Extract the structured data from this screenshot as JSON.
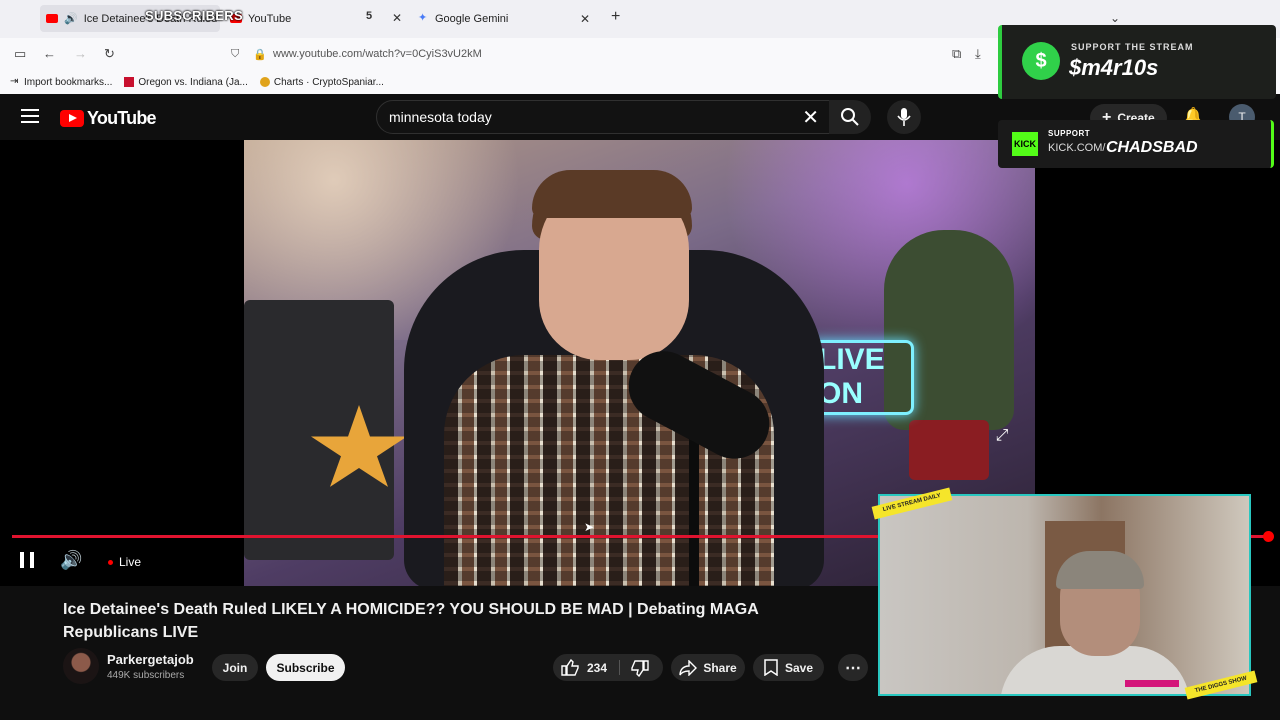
{
  "browser": {
    "tabs": [
      {
        "title": "Ice Detainee's Death Ruled"
      },
      {
        "title": "YouTube"
      },
      {
        "title": "Google Gemini"
      }
    ],
    "tab_overlay_text": "SUBSCRIBERS",
    "tab_count": "5",
    "url": "www.youtube.com/watch?v=0CyiS3vU2kM",
    "bookmarks": [
      "Import bookmarks...",
      "Oregon vs. Indiana (Ja...",
      "Charts · CryptoSpaniar..."
    ]
  },
  "youtube": {
    "logo_text": "YouTube",
    "search_query": "minnesota today",
    "create_label": "Create",
    "avatar_initial": "T"
  },
  "video": {
    "live_label": "Live",
    "progress": 1.0,
    "title": "Ice Detainee's Death Ruled LIKELY A HOMICIDE?? YOU SHOULD BE MAD | Debating MAGA Republicans LIVE",
    "neon_text": "LIVE ON",
    "channel": {
      "name": "Parkergetajob",
      "subscribers": "449K subscribers"
    },
    "actions": {
      "join": "Join",
      "subscribe": "Subscribe",
      "likes": "234",
      "share": "Share",
      "save": "Save"
    }
  },
  "overlays": {
    "support": {
      "label": "SUPPORT THE STREAM",
      "tag": "$m4r10s"
    },
    "kick": {
      "label": "SUPPORT",
      "url_prefix": "KICK.COM/",
      "url_name": "CHADSBAD",
      "logo": "KICK"
    },
    "tape_top": "LIVE STREAM DAILY",
    "tape_bottom": "THE DIGGS SHOW"
  },
  "colors": {
    "yt_red": "#ff0000",
    "progress": "#e0132f",
    "support_green": "#2ecc40",
    "kick_green": "#53fc18",
    "cam_border": "#29c7c0"
  }
}
